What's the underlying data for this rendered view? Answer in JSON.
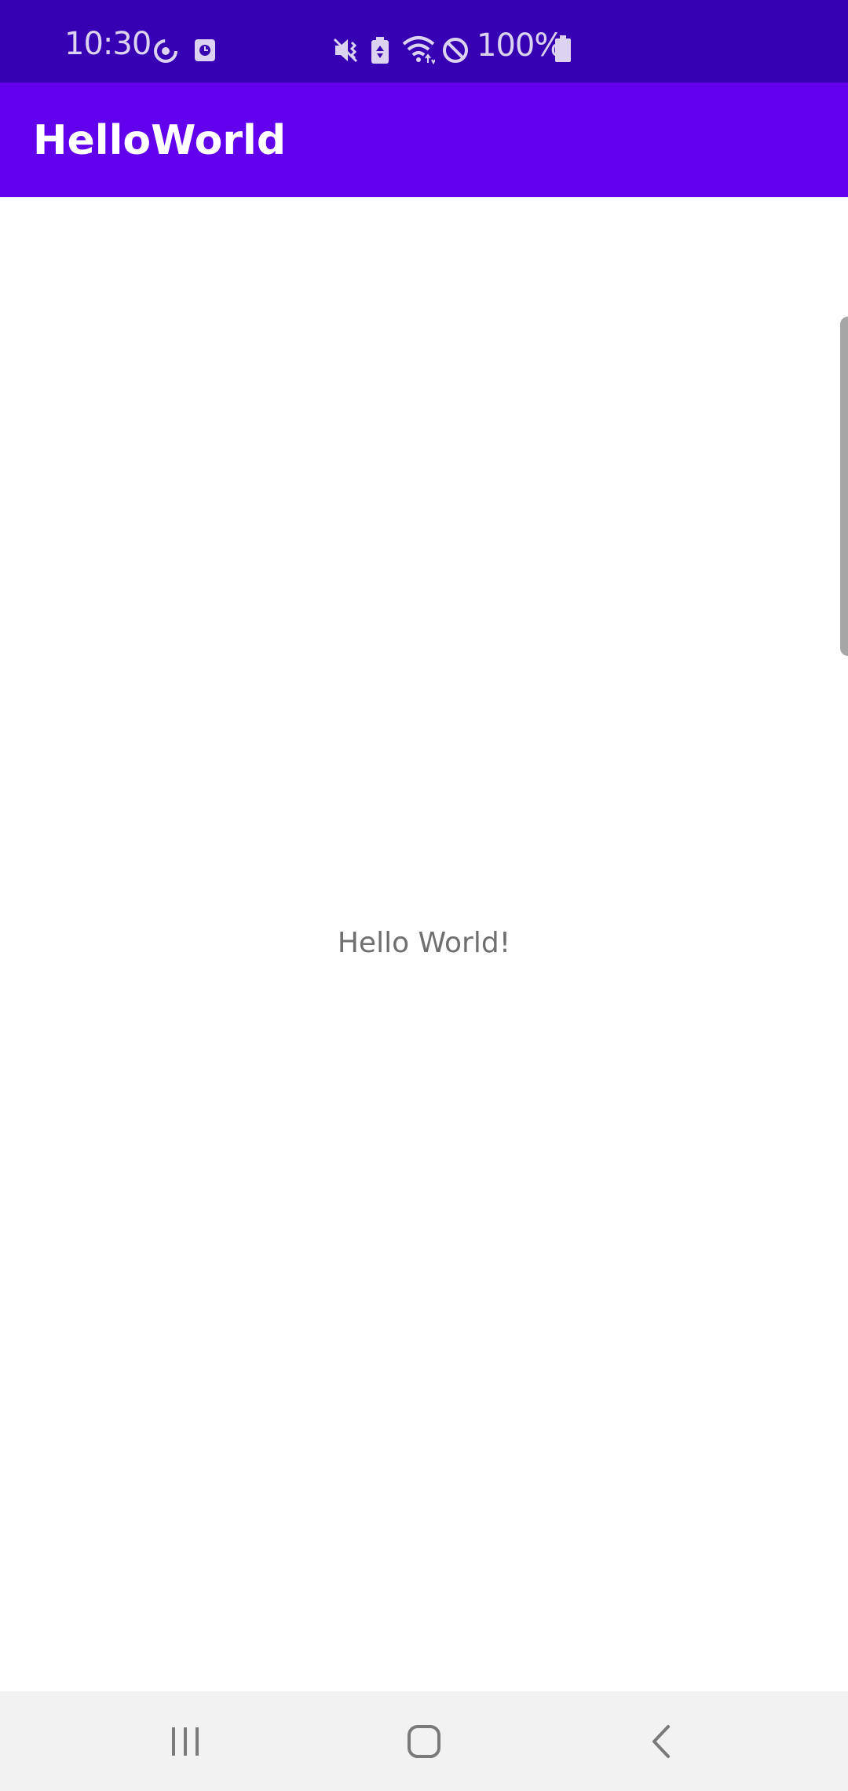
{
  "status_bar": {
    "time": "10:30",
    "battery_percent": "100%",
    "background": "#3700B3",
    "icons": [
      "sync-icon",
      "screen-record-icon",
      "vibrate-mute-icon",
      "battery-saver-icon",
      "wifi-icon",
      "do-not-disturb-icon",
      "battery-icon"
    ]
  },
  "app_bar": {
    "title": "HelloWorld",
    "background": "#6200EE"
  },
  "main": {
    "text": "Hello World!"
  },
  "nav_bar": {
    "buttons": [
      "recent-apps-icon",
      "home-icon",
      "back-icon"
    ]
  }
}
